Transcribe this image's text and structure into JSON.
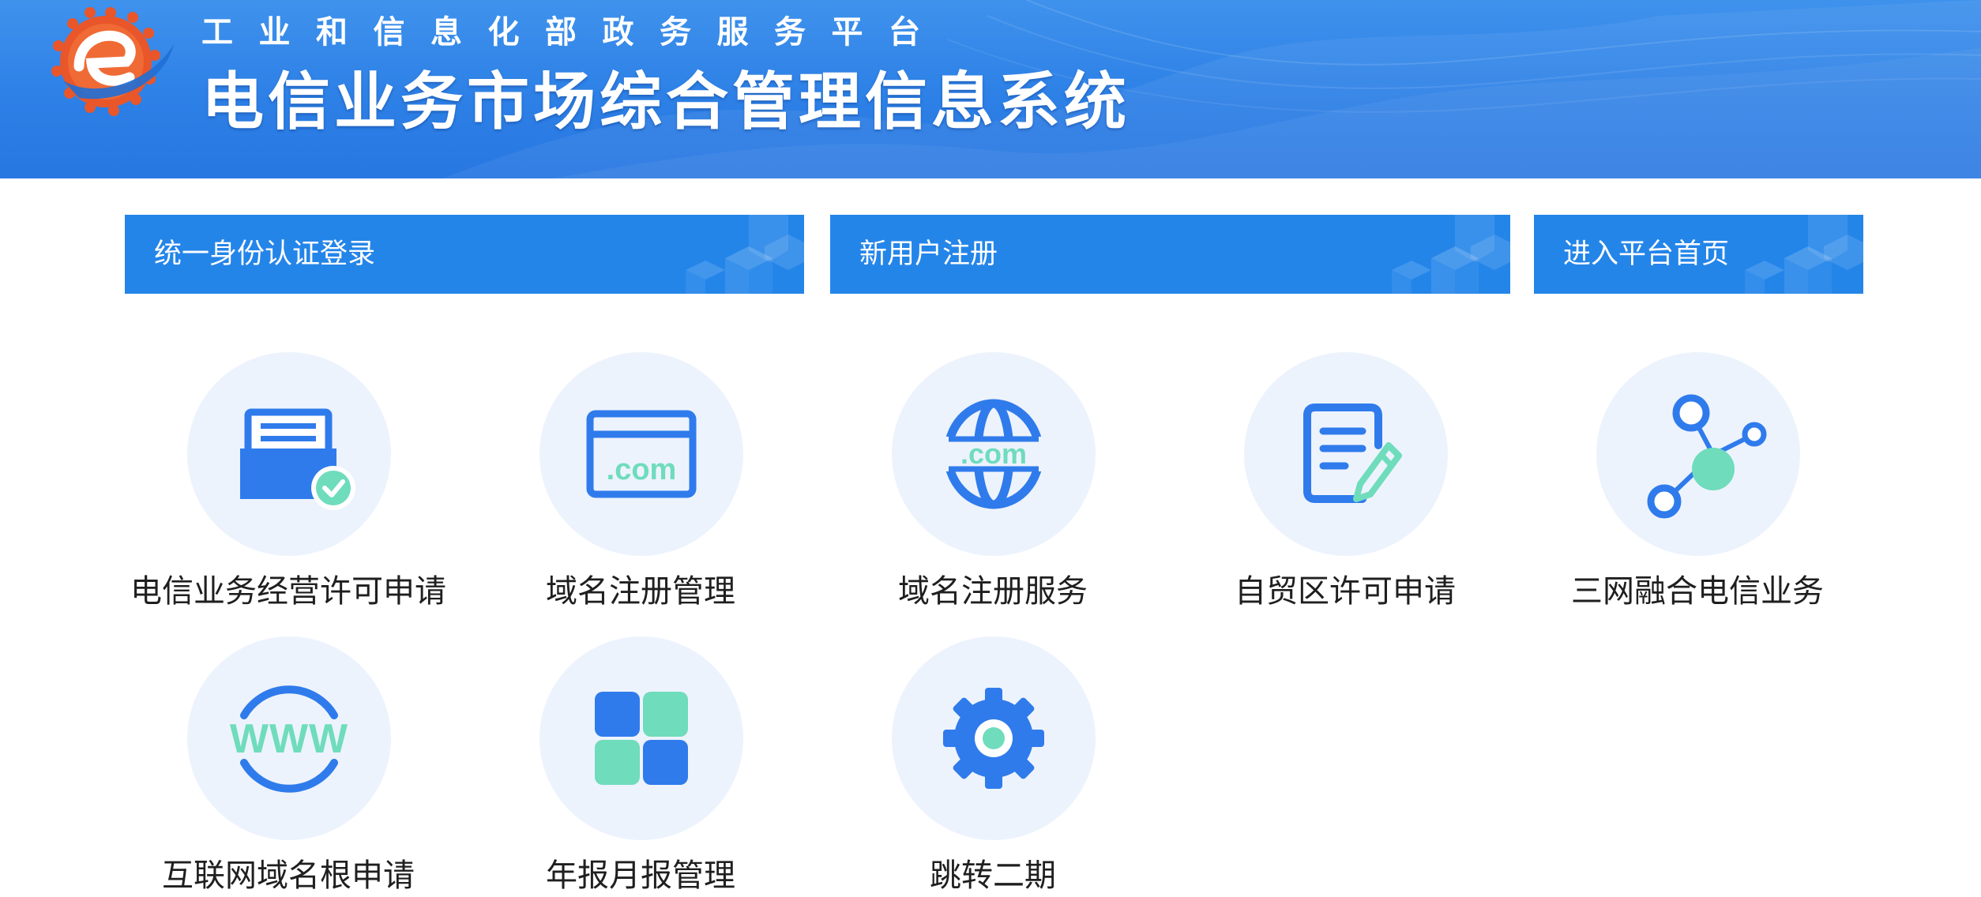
{
  "header": {
    "org_title": "工业和信息化部政务服务平台",
    "system_title": "电信业务市场综合管理信息系统"
  },
  "actions": [
    {
      "label": "统一身份认证登录"
    },
    {
      "label": "新用户注册"
    },
    {
      "label": "进入平台首页"
    }
  ],
  "services": [
    {
      "label": "电信业务经营许可申请",
      "icon": "license-check-icon"
    },
    {
      "label": "域名注册管理",
      "icon": "dotcom-browser-icon"
    },
    {
      "label": "域名注册服务",
      "icon": "dotcom-globe-icon"
    },
    {
      "label": "自贸区许可申请",
      "icon": "document-edit-icon"
    },
    {
      "label": "三网融合电信业务",
      "icon": "network-nodes-icon"
    },
    {
      "label": "互联网域名根申请",
      "icon": "www-icon"
    },
    {
      "label": "年报月报管理",
      "icon": "grid-blocks-icon"
    },
    {
      "label": "跳转二期",
      "icon": "gear-icon"
    }
  ],
  "icon_text": {
    "dotcom_browser": ".com",
    "dotcom_globe": ".com",
    "www": "WWW"
  },
  "colors": {
    "header_blue": "#2d80e6",
    "bar_blue": "#2485e9",
    "icon_blue": "#2f7bec",
    "icon_green": "#6fdcbc",
    "circle_bg": "#edf3fd",
    "logo_orange": "#e9562a"
  }
}
